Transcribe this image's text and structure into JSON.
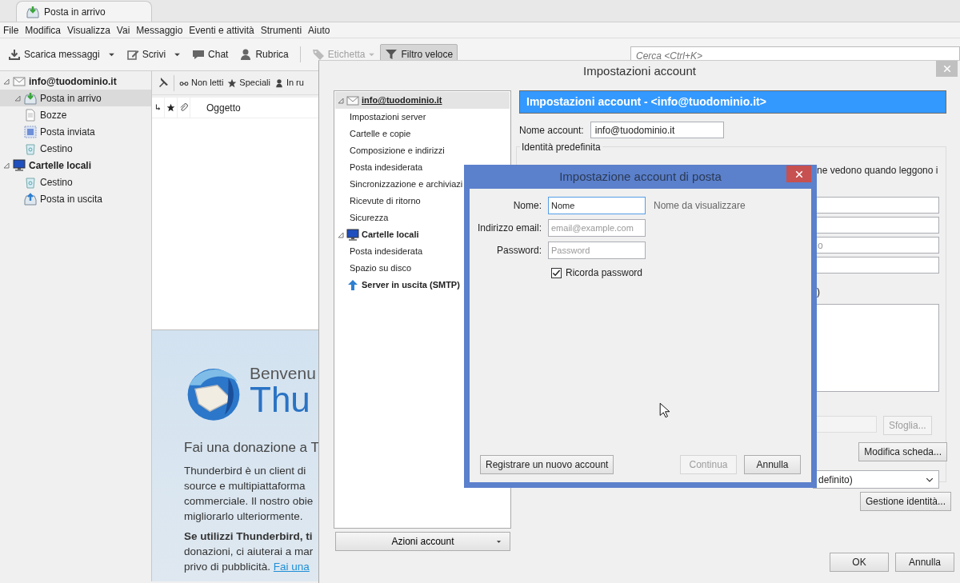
{
  "tab": {
    "label": "Posta in arrivo",
    "selected": true
  },
  "menu": [
    "File",
    "Modifica",
    "Visualizza",
    "Vai",
    "Messaggio",
    "Eventi e attività",
    "Strumenti",
    "Aiuto"
  ],
  "toolbar": [
    {
      "buttons": [
        {
          "kind": "download",
          "label": "Scarica messaggi",
          "dropdown": true,
          "disabled": false,
          "pressed": false
        },
        {
          "kind": "compose",
          "label": "Scrivi",
          "dropdown": true,
          "disabled": false,
          "pressed": false
        },
        {
          "kind": "chat",
          "label": "Chat",
          "dropdown": false,
          "disabled": false,
          "pressed": false
        },
        {
          "kind": "contacts",
          "label": "Rubrica",
          "dropdown": false,
          "disabled": false,
          "pressed": false
        }
      ]
    },
    {
      "buttons": [
        {
          "kind": "tag",
          "label": "Etichetta",
          "dropdown": true,
          "disabled": true,
          "pressed": false
        },
        {
          "kind": "filter",
          "label": "Filtro veloce",
          "dropdown": false,
          "disabled": false,
          "pressed": true
        }
      ]
    }
  ],
  "search": {
    "placeholder": "Cerca <Ctrl+K>"
  },
  "folders": [
    {
      "kind": "account",
      "label": "info@tuodominio.it",
      "expanded": true,
      "selected": false,
      "children": [
        {
          "kind": "inbox",
          "label": "Posta in arrivo",
          "expanded": true,
          "selected": true
        },
        {
          "kind": "drafts",
          "label": "Bozze",
          "selected": false
        },
        {
          "kind": "sent",
          "label": "Posta inviata",
          "selected": false
        },
        {
          "kind": "trash",
          "label": "Cestino",
          "selected": false
        }
      ]
    },
    {
      "kind": "local",
      "label": "Cartelle locali",
      "expanded": true,
      "selected": false,
      "children": [
        {
          "kind": "trash",
          "label": "Cestino",
          "selected": false
        },
        {
          "kind": "outbox",
          "label": "Posta in uscita",
          "selected": false
        }
      ]
    }
  ],
  "quick_filter": [
    {
      "kind": "unread",
      "label": "Non letti"
    },
    {
      "kind": "starred",
      "label": "Speciali"
    },
    {
      "kind": "contact",
      "label": "In ru"
    }
  ],
  "columns": [
    "Oggetto"
  ],
  "start_page": {
    "welcome": "Benvenu",
    "product": "Thu",
    "donate_heading": "Fai una donazione a T",
    "paragraphs": [
      {
        "lines": [
          "Thunderbird è un client di",
          "source e multipiattaforma",
          "commerciale. Il nostro obie",
          "migliorarlo ulteriormente."
        ]
      },
      {
        "lines": [
          "**Se utilizzi Thunderbird, ti**",
          "donazioni, ci aiuterai a mar",
          "privo di pubblicità."
        ],
        "link": "Fai una"
      }
    ]
  },
  "settings_dialog": {
    "title": "Impostazioni account",
    "tree": [
      {
        "kind": "account",
        "label": "info@tuodominio.it",
        "expanded": true,
        "selected": true,
        "children": [
          {
            "label": "Impostazioni server",
            "selected": false
          },
          {
            "label": "Cartelle e copie",
            "selected": false
          },
          {
            "label": "Composizione e indirizzi",
            "selected": false
          },
          {
            "label": "Posta indesiderata",
            "selected": false
          },
          {
            "label": "Sincronizzazione e archiviazi",
            "selected": false
          },
          {
            "label": "Ricevute di ritorno",
            "selected": false
          },
          {
            "label": "Sicurezza",
            "selected": false
          }
        ]
      },
      {
        "kind": "local",
        "label": "Cartelle locali",
        "expanded": true,
        "selected": false,
        "children": [
          {
            "label": "Posta indesiderata",
            "selected": false
          },
          {
            "label": "Spazio su disco",
            "selected": false
          }
        ]
      },
      {
        "kind": "smtp",
        "label": "Server in uscita (SMTP)",
        "selected": false
      }
    ],
    "actions_button": "Azioni account",
    "header": "Impostazioni account - <info@tuodominio.it>",
    "account_name": {
      "label": "Nome account:",
      "value": "info@tuodominio.it"
    },
    "identity": {
      "legend": "Identità predefinita",
      "description": "ne vedono quando leggono i",
      "fields": [
        {
          "kind": "text"
        },
        {
          "kind": "text"
        },
        {
          "kind": "text",
          "placeholder": "o"
        },
        {
          "kind": "text"
        }
      ],
      "signature_label": ")",
      "browse_button": {
        "label": "Sfoglia...",
        "disabled": true
      },
      "card_button": "Modifica scheda...",
      "select": {
        "value": "definito)"
      }
    },
    "identities_button": "Gestione identità...",
    "buttons": [
      "OK",
      "Annulla"
    ]
  },
  "setup_dialog": {
    "title": "Impostazione account di posta",
    "fields": [
      {
        "label": "Nome:",
        "value": "Nome",
        "hint": "Nome da visualizzare",
        "focused": true
      },
      {
        "label": "Indirizzo email:",
        "placeholder": "email@example.com",
        "focused": false
      },
      {
        "label": "Password:",
        "placeholder": "Password",
        "focused": false
      }
    ],
    "remember": {
      "label": "Ricorda password",
      "checked": true
    },
    "register_button": "Registrare un nuovo account",
    "buttons": [
      {
        "label": "Continua",
        "disabled": true
      },
      {
        "label": "Annulla",
        "disabled": false
      }
    ]
  }
}
